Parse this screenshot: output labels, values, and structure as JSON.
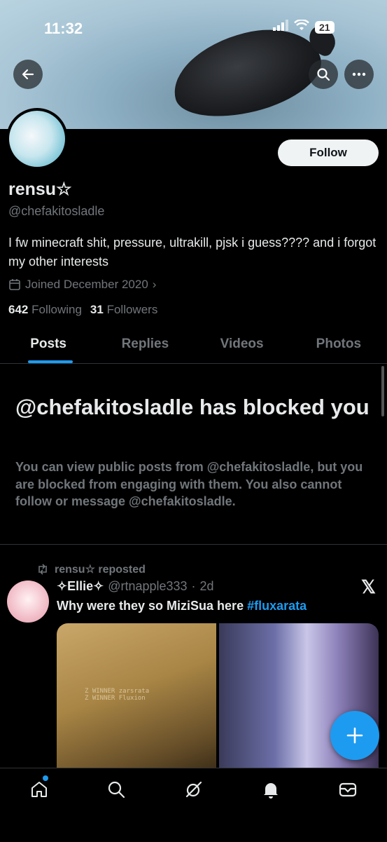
{
  "status_bar": {
    "time": "11:32",
    "battery": "21"
  },
  "profile": {
    "display_name": "rensu☆",
    "handle": "@chefakitosladle",
    "bio": "I fw minecraft shit, pressure, ultrakill, pjsk i guess???? and i forgot my other interests",
    "joined": "Joined December 2020",
    "following_count": "642",
    "following_label": "Following",
    "followers_count": "31",
    "followers_label": "Followers",
    "follow_button": "Follow"
  },
  "tabs": [
    {
      "label": "Posts",
      "active": true
    },
    {
      "label": "Replies",
      "active": false
    },
    {
      "label": "Videos",
      "active": false
    },
    {
      "label": "Photos",
      "active": false
    }
  ],
  "blocked": {
    "title": "@chefakitosladle has blocked you",
    "body": "You can view public posts from @chefakitosladle, but you are blocked from engaging with them. You also cannot follow or message @chefakitosladle."
  },
  "post": {
    "repost_label": "rensu☆ reposted",
    "author_name": "✧Ellie✧",
    "author_handle": "@rtnapple333",
    "time": "2d",
    "text": "Why were they so MiziSua here ",
    "hashtag": "#fluxarata",
    "media_text": "Z WINNER zarsrata\nZ WINNER Fluxion"
  },
  "icons": {
    "back": "back-arrow-icon",
    "search": "search-icon",
    "more": "more-dots-icon",
    "calendar": "calendar-icon",
    "repost": "repost-icon",
    "x_logo": "x-logo-icon",
    "compose": "plus-icon",
    "nav": [
      "home-icon",
      "search-icon",
      "grok-icon",
      "bell-icon",
      "mail-icon"
    ]
  },
  "colors": {
    "accent": "#1d9bf0",
    "secondary_text": "#71767b",
    "background": "#000000"
  }
}
